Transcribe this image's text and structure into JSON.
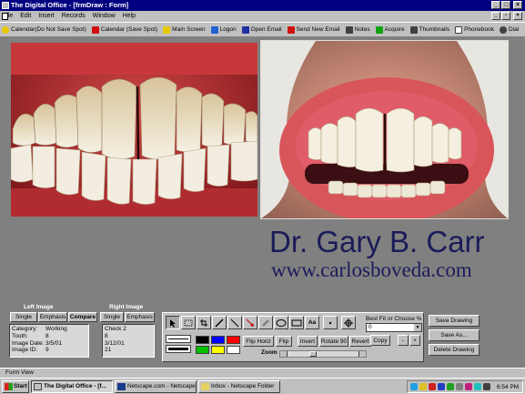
{
  "window": {
    "title": "The Digital Office - [frmDraw : Form]"
  },
  "menu": [
    "File",
    "Edit",
    "Insert",
    "Records",
    "Window",
    "Help"
  ],
  "toolbar": [
    {
      "label": "Calendar(Do Not Save Spot)",
      "icon": "smiley-icon",
      "color": "#e8c800"
    },
    {
      "label": "Calendar (Save Spot)",
      "icon": "calendar-icon",
      "color": "#d01010"
    },
    {
      "label": "Main Screen",
      "icon": "home-icon",
      "color": "#e8c800"
    },
    {
      "label": "Logon",
      "icon": "key-icon",
      "color": "#2060d0"
    },
    {
      "label": "Open Email",
      "icon": "mail-icon",
      "color": "#2030a0"
    },
    {
      "label": "Send New Email",
      "icon": "send-mail-icon",
      "color": "#d01010"
    },
    {
      "label": "Notes",
      "icon": "notes-icon",
      "color": "#404040"
    },
    {
      "label": "Acquire",
      "icon": "acquire-icon",
      "color": "#10a010"
    },
    {
      "label": "Thumbnails",
      "icon": "thumbnails-icon",
      "color": "#404040"
    },
    {
      "label": "Phonebook",
      "icon": "phonebook-icon",
      "color": "#ffffff"
    },
    {
      "label": "Dial",
      "icon": "phone-icon",
      "color": "#404040"
    }
  ],
  "doctor": {
    "name": "Dr. Gary B. Carr",
    "url": "www.carlosboveda.com"
  },
  "left_image": {
    "heading": "Left Image",
    "tabs": [
      "Single",
      "Emphasis",
      "Compare"
    ],
    "fields": [
      {
        "key": "Category:",
        "value": "Working"
      },
      {
        "key": "Tooth:",
        "value": "8"
      },
      {
        "key": "Image Date:",
        "value": "3/5/01"
      },
      {
        "key": "Image ID:",
        "value": "9"
      }
    ]
  },
  "right_image": {
    "heading": "Right Image",
    "tabs": [
      "Single",
      "Emphasis"
    ],
    "values": [
      "Check 2",
      "8",
      "3/12/01",
      "21"
    ]
  },
  "drawing": {
    "tools": [
      "pointer-tool-icon",
      "rectangle-select-icon",
      "crop-icon",
      "pen-icon",
      "line-icon",
      "arrow-icon",
      "brush-icon",
      "ellipse-icon",
      "rectangle-icon",
      "text-tool-icon",
      "point-icon",
      "crosshair-icon"
    ],
    "text_tool_label": "Aa",
    "colors": [
      "#000000",
      "#0000ff",
      "#ff0000",
      "#00c000",
      "#ffff00",
      "#ffffff"
    ],
    "buttons": [
      "Flip Horiz",
      "Flip",
      "Invert",
      "Rotate 90",
      "Revert",
      "Copy"
    ],
    "zoom_label": "Zoom",
    "fit_label": "Best Fit or Choose %",
    "fit_value": "0",
    "minus": "-",
    "plus": "+"
  },
  "actions": [
    "Save Drawing",
    "Save As...",
    "Delete Drawing"
  ],
  "status": "Form View",
  "taskbar": {
    "start": "Start",
    "tasks": [
      "The Digital Office - [f...",
      "Netscape.com - Netscape",
      "Inbox - Netscape Folder"
    ],
    "clock": "6:54 PM"
  }
}
